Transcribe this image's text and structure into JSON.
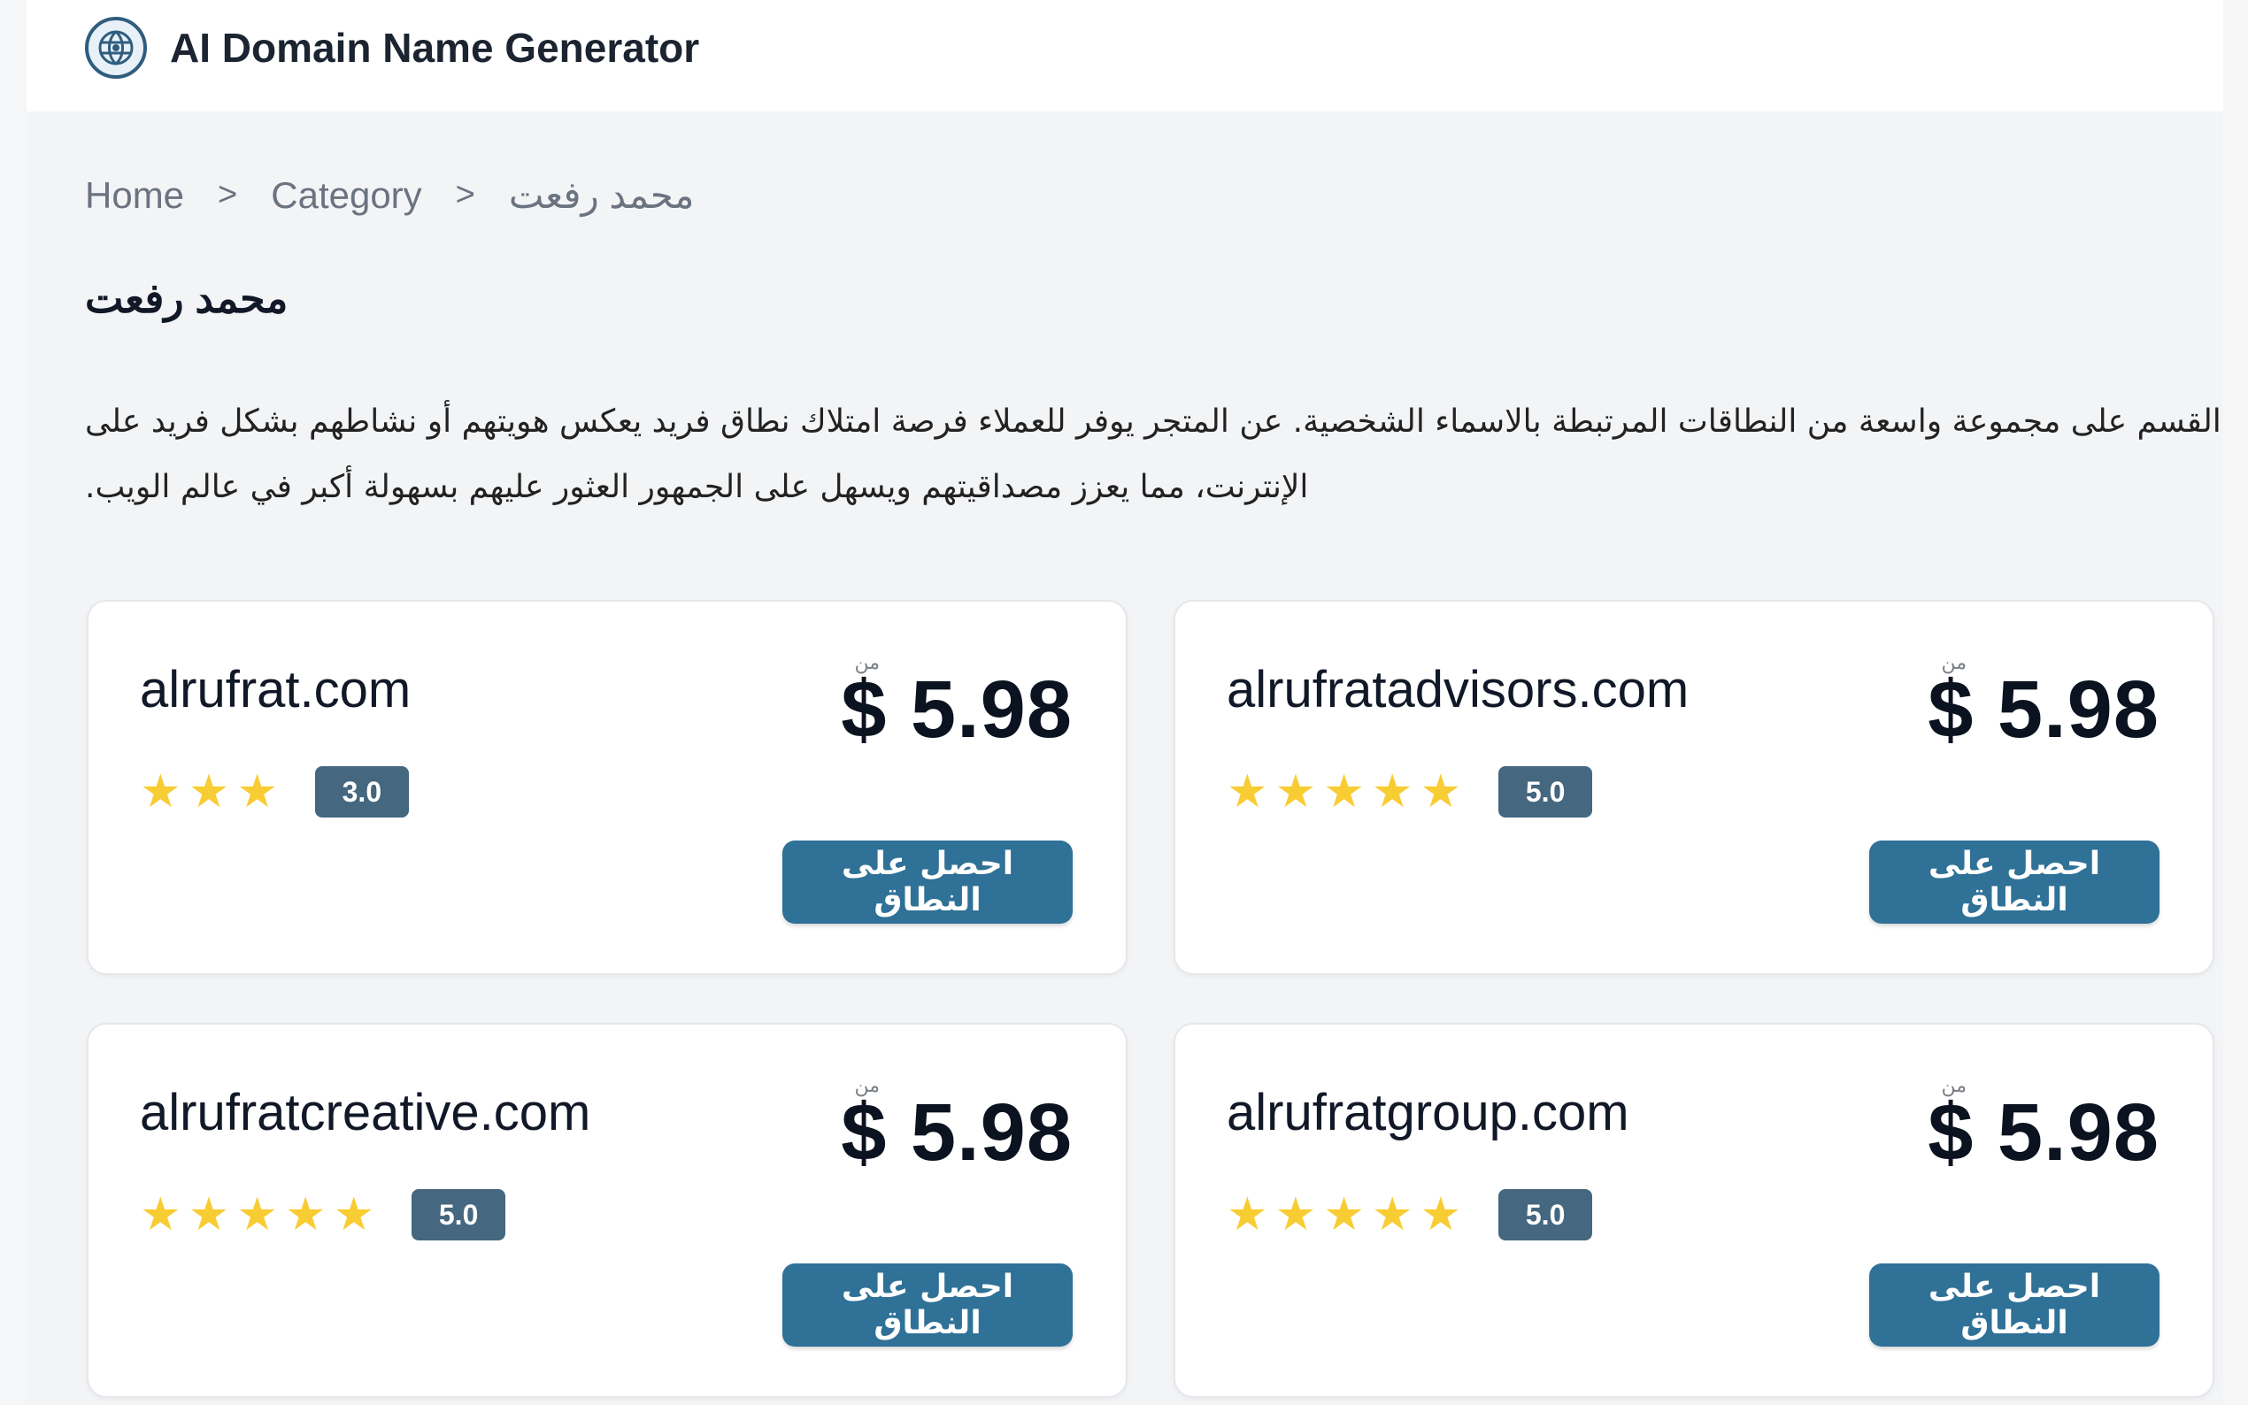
{
  "header": {
    "brand": "AI Domain Name Generator",
    "logo_icon": "brain-globe-icon",
    "brand_color": "#2f5d7e"
  },
  "breadcrumb": {
    "items": [
      "Home",
      "Category",
      "محمد رفعت"
    ],
    "separator": ">"
  },
  "page": {
    "title": "محمد رفعت",
    "description": "القسم على مجموعة واسعة من النطاقات المرتبطة بالاسماء الشخصية. عن المتجر يوفر للعملاء فرصة امتلاك نطاق فريد يعكس هويتهم أو نشاطهم بشكل فريد على الإنترنت، مما يعزز مصداقيتهم ويسهل على الجمهور العثور عليهم بسهولة أكبر في عالم الويب."
  },
  "cards": [
    {
      "domain": "alrufrat.com",
      "price_label": "من",
      "price": "$ 5.98",
      "stars": 3,
      "rating": "3.0",
      "button": "احصل على النطاق"
    },
    {
      "domain": "alrufratadvisors.com",
      "price_label": "من",
      "price": "$ 5.98",
      "stars": 5,
      "rating": "5.0",
      "button": "احصل على النطاق"
    },
    {
      "domain": "alrufratcreative.com",
      "price_label": "من",
      "price": "$ 5.98",
      "stars": 5,
      "rating": "5.0",
      "button": "احصل على النطاق"
    },
    {
      "domain": "alrufratgroup.com",
      "price_label": "من",
      "price": "$ 5.98",
      "stars": 5,
      "rating": "5.0",
      "button": "احصل على النطاق"
    }
  ],
  "colors": {
    "button": "#2f7197",
    "rating_badge": "#45677f",
    "star": "#f8cc33",
    "background": "#f3f4f6"
  }
}
